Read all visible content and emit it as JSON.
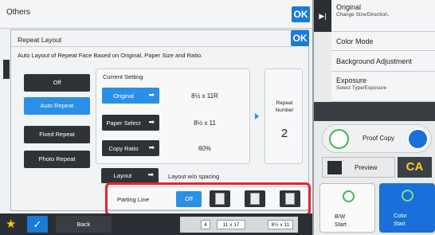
{
  "background": {
    "title": "Others",
    "ok_label": "OK"
  },
  "right_panel": {
    "items": [
      {
        "title": "Original",
        "sub": "Change Size/Direction."
      },
      {
        "title": "Color Mode",
        "sub": ""
      },
      {
        "title": "Background Adjustment",
        "sub": ""
      },
      {
        "title": "Exposure",
        "sub": "Select Type/Exposure"
      }
    ],
    "proof_copy": "Proof Copy",
    "preview": "Preview",
    "ca": "CA",
    "start_bw": [
      "B/W",
      "Start"
    ],
    "start_color": [
      "Color",
      "Start"
    ]
  },
  "dialog": {
    "title": "Repeat Layout",
    "ok_label": "OK",
    "subtitle": "Auto Layout of Repeat Face Based on Original, Paper Size and Ratio.",
    "modes": [
      {
        "label": "Off",
        "selected": false
      },
      {
        "label": "Auto Repeat",
        "selected": true
      },
      {
        "label": "Fixed Repeat",
        "selected": false
      },
      {
        "label": "Photo Repeat",
        "selected": false
      }
    ],
    "current_setting": {
      "label": "Current Setting",
      "original_btn": "Original",
      "original_val": "8½ x 11R",
      "paper_btn": "Paper Select",
      "paper_val": "8½ x 11",
      "ratio_btn": "Copy Ratio",
      "ratio_val": "60%"
    },
    "repeat": {
      "label1": "Repeat",
      "label2": "Number",
      "value": "2"
    },
    "layout": {
      "btn": "Layout",
      "value": "Layout w/o spacing"
    },
    "parting_line": {
      "label": "Parting Line",
      "off": "Off"
    }
  },
  "bottom": {
    "back": "Back",
    "strip": [
      "4",
      "11 x 17",
      "8½ x 11"
    ]
  },
  "colors": {
    "accent": "#2a8fe6",
    "highlight": "#e3262f",
    "dark": "#2f3338"
  }
}
